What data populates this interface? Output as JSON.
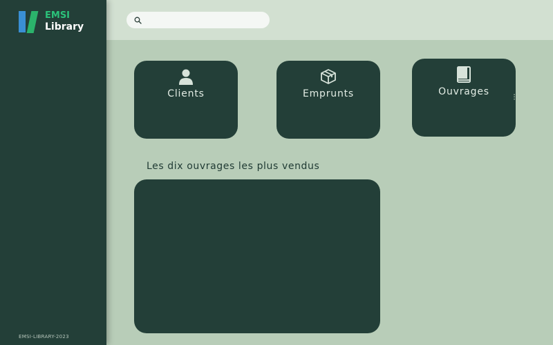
{
  "sidebar": {
    "logo_line1": "EMSI",
    "logo_line2": "Library",
    "footer": "EMSI-LIBRARY-2023"
  },
  "header": {
    "search_placeholder": "",
    "search_value": ""
  },
  "cards": {
    "clients": {
      "label": "Clients",
      "icon": "user-icon"
    },
    "emprunts": {
      "label": "Emprunts",
      "icon": "box-icon"
    },
    "ouvrages": {
      "label": "Ouvrages",
      "icon": "book-icon"
    }
  },
  "main": {
    "section_title": "Les dix ouvrages les plus vendus"
  },
  "colors": {
    "sidebar_bg": "#233f38",
    "main_bg": "#b8cdb8",
    "header_bg": "#d2e0d1",
    "card_bg": "#233f38",
    "logo_green": "#2bc27a",
    "logo_blue": "#3a8fd4"
  }
}
